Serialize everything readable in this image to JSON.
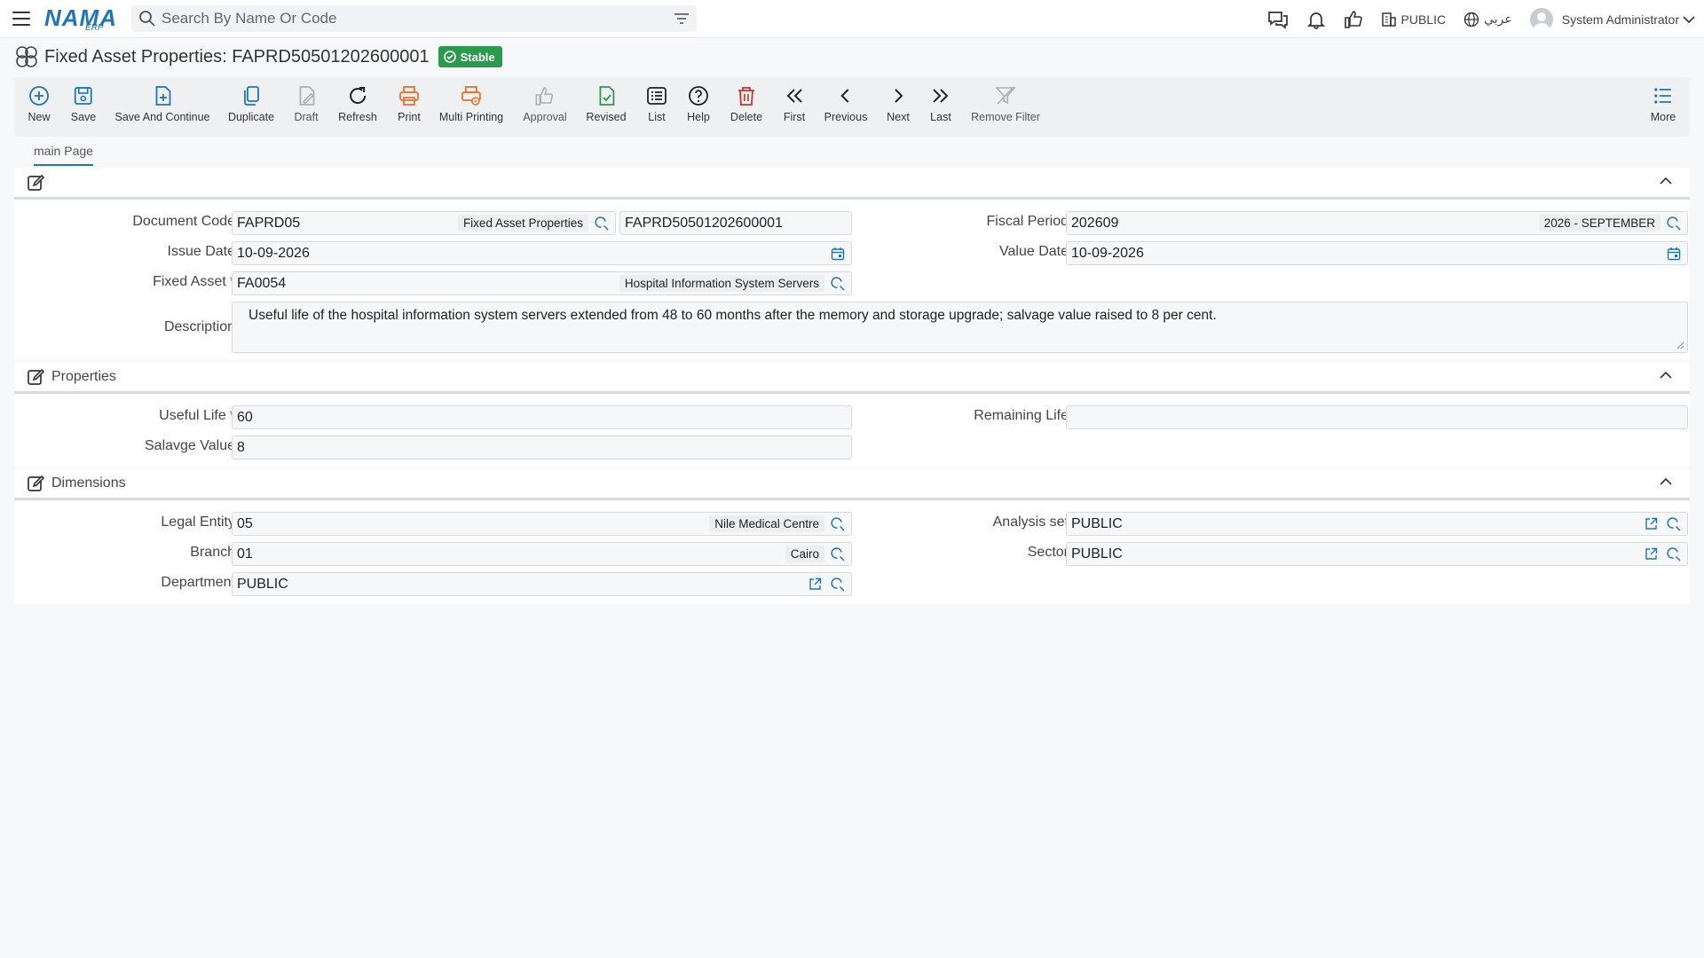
{
  "header": {
    "logo_main": "NAMA",
    "logo_sub": "ERP",
    "search_placeholder": "Search By Name Or Code",
    "org_label": "PUBLIC",
    "language_label": "عربي",
    "user_name": "System Administrator"
  },
  "title": {
    "text": "Fixed Asset Properties: FAPRD50501202600001",
    "status": "Stable"
  },
  "toolbar": [
    {
      "name": "new",
      "label": "New"
    },
    {
      "name": "save",
      "label": "Save"
    },
    {
      "name": "save-and-continue",
      "label": "Save And Continue"
    },
    {
      "name": "duplicate",
      "label": "Duplicate"
    },
    {
      "name": "draft",
      "label": "Draft"
    },
    {
      "name": "refresh",
      "label": "Refresh"
    },
    {
      "name": "print",
      "label": "Print"
    },
    {
      "name": "multi-printing",
      "label": "Multi Printing"
    },
    {
      "name": "approval",
      "label": "Approval"
    },
    {
      "name": "revised",
      "label": "Revised"
    },
    {
      "name": "list",
      "label": "List"
    },
    {
      "name": "help",
      "label": "Help"
    },
    {
      "name": "delete",
      "label": "Delete"
    },
    {
      "name": "first",
      "label": "First"
    },
    {
      "name": "previous",
      "label": "Previous"
    },
    {
      "name": "next",
      "label": "Next"
    },
    {
      "name": "last",
      "label": "Last"
    },
    {
      "name": "remove-filter",
      "label": "Remove Filter"
    },
    {
      "name": "more",
      "label": "More"
    }
  ],
  "tabs": [
    {
      "label": "main Page"
    }
  ],
  "main": {
    "document_code": {
      "label": "Document Code",
      "value": "FAPRD05",
      "name": "Fixed Asset Properties",
      "code": "FAPRD50501202600001"
    },
    "fiscal_period": {
      "label": "Fiscal Period",
      "value": "202609",
      "name": "2026 - SEPTEMBER"
    },
    "issue_date": {
      "label": "Issue Date",
      "value": "10-09-2026"
    },
    "value_date": {
      "label": "Value Date",
      "value": "10-09-2026"
    },
    "fixed_asset": {
      "label": "Fixed Asset",
      "required": "*",
      "value": "FA0054",
      "name": "Hospital Information System Servers"
    },
    "description": {
      "label": "Description",
      "value": "Useful life of the hospital information system servers extended from 48 to 60 months after the memory and storage upgrade; salvage value raised to 8 per cent."
    }
  },
  "properties": {
    "title": "Properties",
    "useful_life": {
      "label": "Useful Life",
      "required": "*",
      "value": "60"
    },
    "remaining_life": {
      "label": "Remaining Life",
      "value": ""
    },
    "salvage_value": {
      "label": "Salavge Value",
      "value": "8"
    }
  },
  "dimensions": {
    "title": "Dimensions",
    "legal_entity": {
      "label": "Legal Entity",
      "value": "05",
      "name": "Nile Medical Centre"
    },
    "analysis_set": {
      "label": "Analysis set",
      "value": "PUBLIC"
    },
    "branch": {
      "label": "Branch",
      "value": "01",
      "name": "Cairo"
    },
    "sector": {
      "label": "Sector",
      "value": "PUBLIC"
    },
    "department": {
      "label": "Department",
      "value": "PUBLIC"
    }
  },
  "colors": {
    "accent": "#1e75b8",
    "stable": "#2a9a4d",
    "print": "#e8712b",
    "delete": "#c0392b"
  }
}
